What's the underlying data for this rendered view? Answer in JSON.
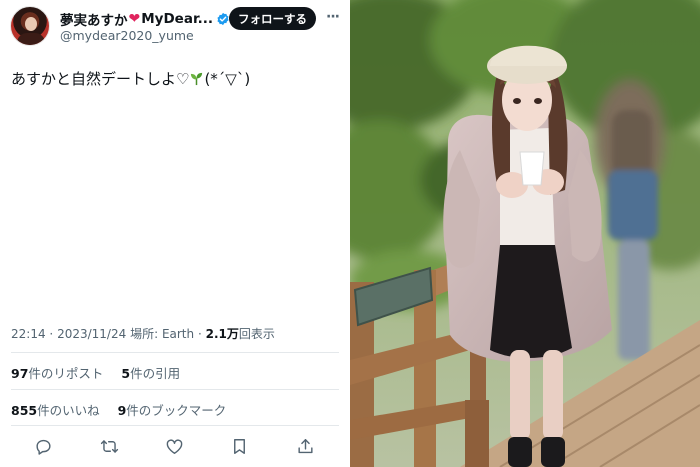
{
  "tweet": {
    "display_name": "夢実あすか",
    "display_name_suffix": "MyDear...",
    "handle": "@mydear2020_yume",
    "follow_label": "フォローする",
    "text": "あすかと自然デートしよ♡",
    "text_suffix": "(*´▽`)",
    "time": "22:14",
    "date": "2023/11/24",
    "location_label": "場所:",
    "location": "Earth",
    "views_count": "2.1万",
    "views_label": "回表示",
    "reposts_count": "97",
    "reposts_label": "件のリポスト",
    "quotes_count": "5",
    "quotes_label": "件の引用",
    "likes_count": "855",
    "likes_label": "件のいいね",
    "bookmarks_count": "9",
    "bookmarks_label": "件のブックマーク"
  },
  "icons": [
    "heart-icon",
    "verified-icon",
    "more-icon",
    "sprout-icon",
    "reply-icon",
    "repost-icon",
    "like-icon",
    "bookmark-icon",
    "share-icon"
  ],
  "colors": {
    "verified": "#1d9bf0",
    "heart": "#e0245e",
    "text": "#0f1419",
    "muted": "#536471",
    "follow_bg": "#0f1419"
  }
}
